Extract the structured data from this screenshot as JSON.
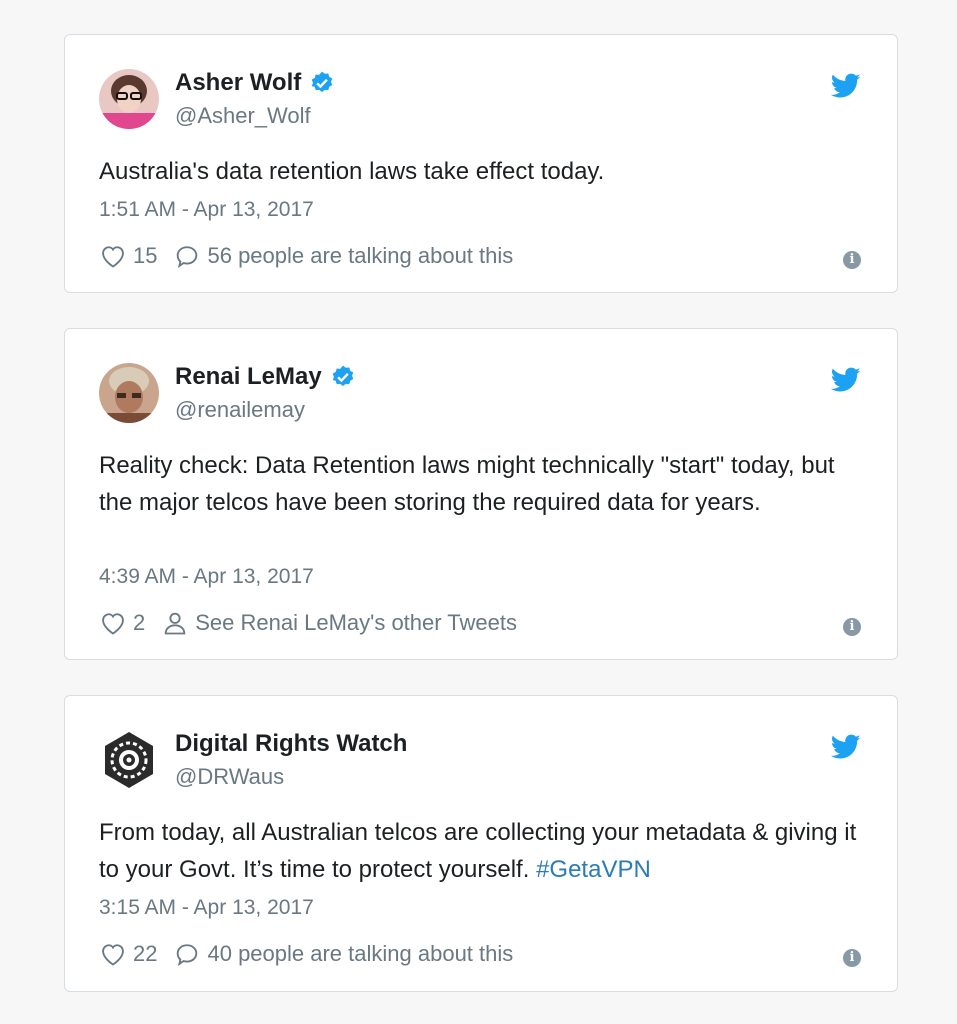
{
  "colors": {
    "accent": "#1da1f2",
    "verified": "#1da1f2",
    "hashtag": "#2b7bb9",
    "muted": "#697882",
    "text": "#1c2022"
  },
  "tweets": [
    {
      "name": "Asher Wolf",
      "verified": true,
      "handle": "@Asher_Wolf",
      "text": "Australia's data retention laws take effect today.",
      "time": "1:51 AM - Apr 13, 2017",
      "likes": "15",
      "secondary_icon": "speech-bubble-icon",
      "secondary": "56 people are talking about this"
    },
    {
      "name": "Renai LeMay",
      "verified": true,
      "handle": "@renailemay",
      "text": "Reality check: Data Retention laws might technically \"start\" today, but the major telcos have been storing the required data for years.",
      "time": "4:39 AM - Apr 13, 2017",
      "likes": "2",
      "secondary_icon": "person-icon",
      "secondary": "See Renai LeMay's other Tweets"
    },
    {
      "name": "Digital Rights Watch",
      "verified": false,
      "handle": "@DRWaus",
      "text": "From today, all Australian telcos are collecting your metadata & giving it to your Govt. It’s time to protect yourself. ",
      "hashtag": "#GetaVPN",
      "time": "3:15 AM - Apr 13, 2017",
      "likes": "22",
      "secondary_icon": "speech-bubble-icon",
      "secondary": "40 people are talking about this"
    }
  ]
}
